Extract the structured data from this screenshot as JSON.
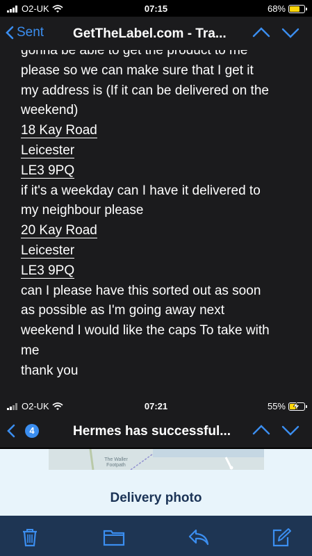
{
  "status1": {
    "carrier": "O2-UK",
    "time": "07:15",
    "battery": "68%",
    "battery_color": "#ffd60a",
    "battery_level": 0.68
  },
  "navbar1": {
    "back_label": "Sent",
    "title": "GetTheLabel.com - Tra..."
  },
  "message": {
    "lines": [
      {
        "text": "gonna be able to get the product to me",
        "underline": false
      },
      {
        "text": "please so we can make sure that I get it",
        "underline": false
      },
      {
        "text": "my address is (If it can be delivered on the",
        "underline": false
      },
      {
        "text": "weekend)",
        "underline": false
      },
      {
        "text": "18 Kay Road",
        "underline": true
      },
      {
        "text": " Leicester",
        "underline": true
      },
      {
        "text": "LE3 9PQ",
        "underline": true
      },
      {
        "text": " if it's a weekday can I have it delivered to",
        "underline": false
      },
      {
        "text": "my neighbour please",
        "underline": false
      },
      {
        "text": "20 Kay Road",
        "underline": true
      },
      {
        "text": " Leicester",
        "underline": true
      },
      {
        "text": "LE3 9PQ",
        "underline": true
      },
      {
        "text": "can I please have this sorted out as soon",
        "underline": false
      },
      {
        "text": "as possible as I'm going away next",
        "underline": false
      },
      {
        "text": "weekend I would like the caps  To take with",
        "underline": false
      },
      {
        "text": "me",
        "underline": false
      },
      {
        "text": "thank you",
        "underline": false
      }
    ]
  },
  "status2": {
    "carrier": "O2-UK",
    "time": "07:21",
    "battery": "55%",
    "battery_color": "#ffd60a",
    "battery_level": 0.55,
    "charging": true
  },
  "navbar2": {
    "badge": "4",
    "title": "Hermes has successful..."
  },
  "delivery": {
    "map_label": "The Waller Footpath",
    "heading": "Delivery photo"
  },
  "toolbar": {
    "icons": [
      "trash-icon",
      "folder-icon",
      "reply-icon",
      "compose-icon"
    ]
  }
}
